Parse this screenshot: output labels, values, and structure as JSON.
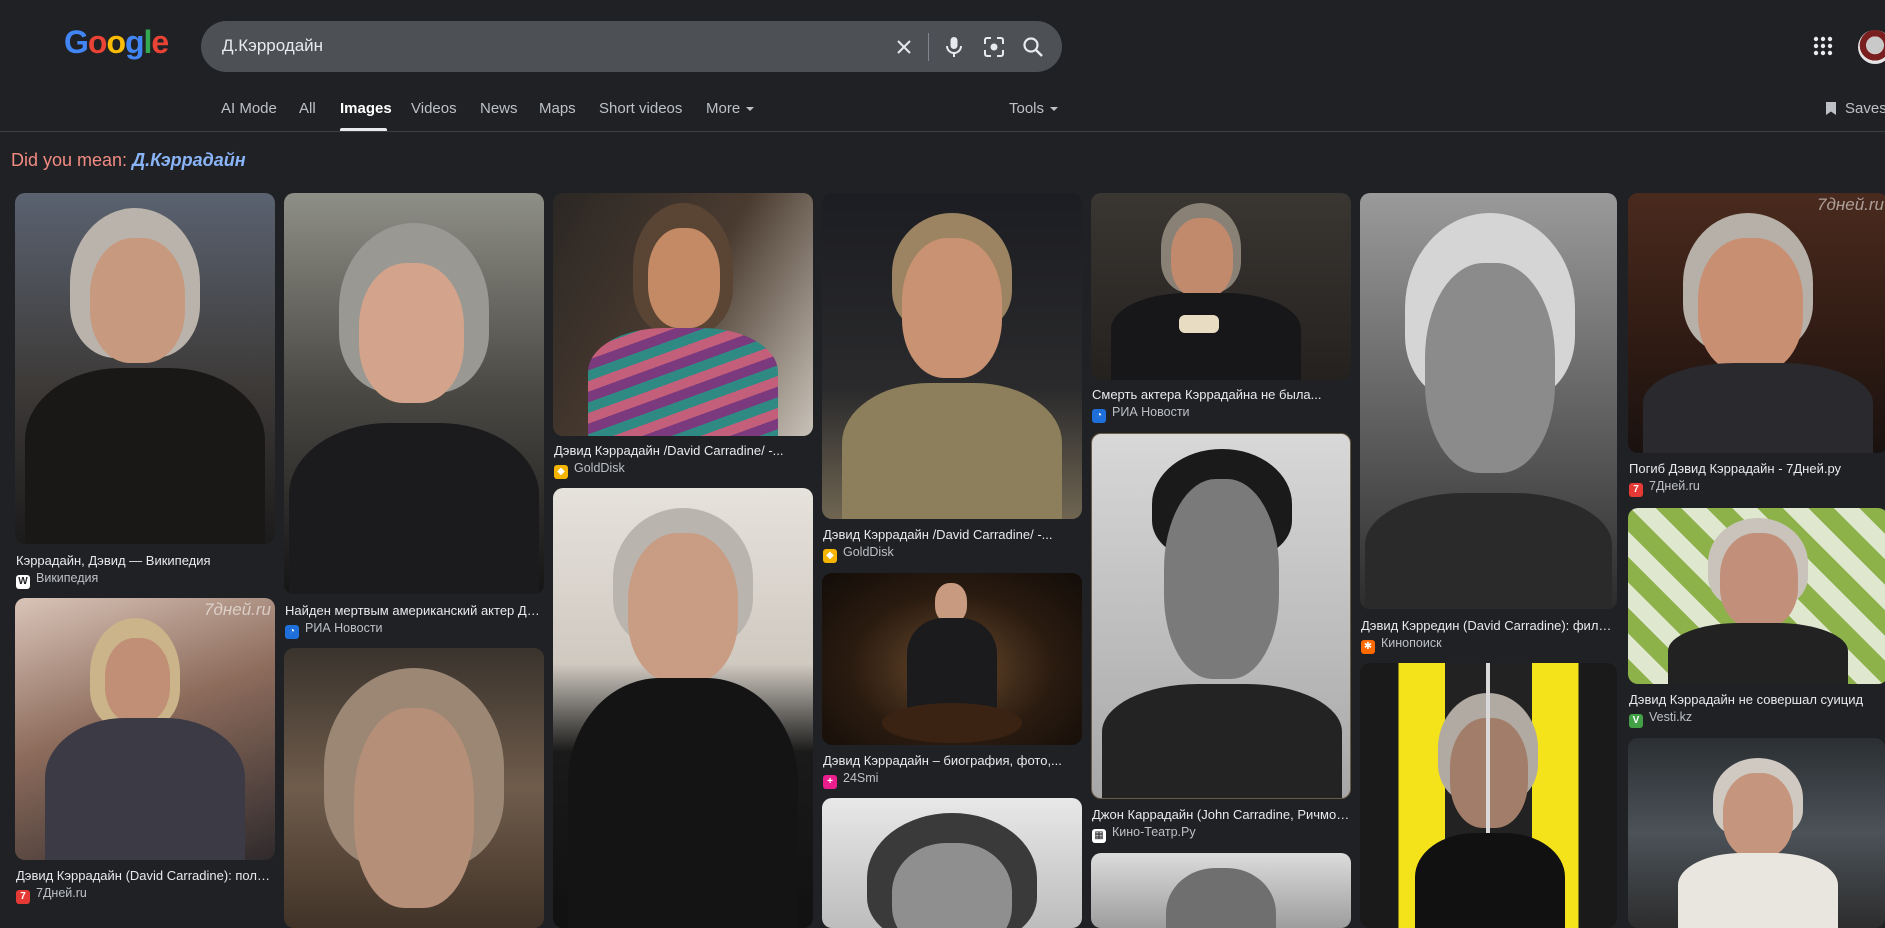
{
  "colors": {
    "background": "#202124",
    "searchbox": "#4d5156",
    "did_you_mean_label": "#f28b82",
    "did_you_mean_link": "#8ab4f8"
  },
  "logo": {
    "text": "Google"
  },
  "search": {
    "query": "Д.Кэрродайн"
  },
  "tabs": [
    {
      "label": "AI Mode"
    },
    {
      "label": "All"
    },
    {
      "label": "Images"
    },
    {
      "label": "Videos"
    },
    {
      "label": "News"
    },
    {
      "label": "Maps"
    },
    {
      "label": "Short videos"
    },
    {
      "label": "More"
    }
  ],
  "tools": {
    "label": "Tools"
  },
  "saves": {
    "label": "Saves"
  },
  "did_you_mean": {
    "label": "Did you mean:",
    "suggestion": "Д.Кэррадайн"
  },
  "results": [
    {
      "title": "Кэррадайн, Дэвид — Википедия",
      "source": "Википедия",
      "favicon": "wikipedia-icon"
    },
    {
      "title": "Дэвид Кэррадайн (David Carradine): полна...",
      "source": "7Дней.ru",
      "favicon": "7days-icon",
      "watermark": "7дней.ru"
    },
    {
      "title": "Найден мертвым американский актер Дэви...",
      "source": "РИА Новости",
      "favicon": "ria-icon"
    },
    {
      "title": "Дэвид Кэррадайн /David Carradine/ -...",
      "source": "GoldDisk",
      "favicon": "golddisk-icon"
    },
    {
      "title": "Дэвид Кэррадайн /David Carradine/ -...",
      "source": "GoldDisk",
      "favicon": "golddisk-icon"
    },
    {
      "title": "Дэвид Кэррадайн – биография, фото,...",
      "source": "24Smi",
      "favicon": "24smi-icon"
    },
    {
      "title": "Смерть актера Кэррадайна не была...",
      "source": "РИА Новости",
      "favicon": "ria-icon"
    },
    {
      "title": "Джон Каррадайн (John Carradine, Ричмон...",
      "source": "Кино-Театр.Ру",
      "favicon": "kinoteatr-icon"
    },
    {
      "title": "Дэвид Кэрредин (David Carradine): фильм...",
      "source": "Кинопоиск",
      "favicon": "kinopoisk-icon"
    },
    {
      "title": "Погиб Дэвид Кэррадайн - 7Дней.ру",
      "source": "7Дней.ru",
      "favicon": "7days-icon",
      "watermark": "7дней.ru"
    },
    {
      "title": "Дэвид Кэррадайн не совершал суицид",
      "source": "Vesti.kz",
      "favicon": "vesti-icon"
    }
  ]
}
